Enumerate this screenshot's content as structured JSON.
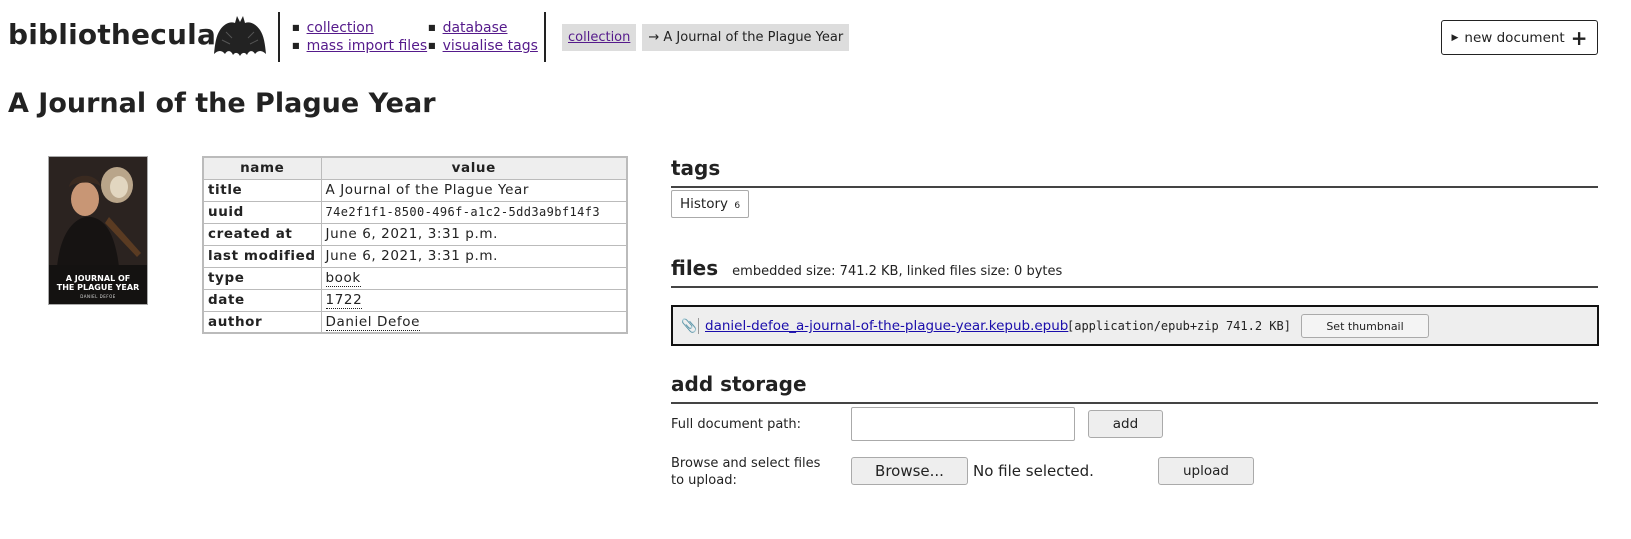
{
  "header": {
    "brand": "bibliothecula",
    "nav_col1": [
      "collection",
      "mass import files"
    ],
    "nav_col2": [
      "database",
      "visualise tags"
    ],
    "breadcrumb": {
      "link": "collection",
      "current": "→ A Journal of the Plague Year"
    },
    "new_document": "new document"
  },
  "page_title": "A Journal of the Plague Year",
  "thumbnail": {
    "title_line1": "A JOURNAL OF",
    "title_line2": "THE PLAGUE YEAR",
    "author": "DANIEL DEFOE"
  },
  "metadata": {
    "col_name": "name",
    "col_value": "value",
    "rows": [
      {
        "name": "title",
        "value": "A Journal of the Plague Year"
      },
      {
        "name": "uuid",
        "value": "74e2f1f1-8500-496f-a1c2-5dd3a9bf14f3"
      },
      {
        "name": "created at",
        "value": "June 6, 2021, 3:31 p.m."
      },
      {
        "name": "last modified",
        "value": "June 6, 2021, 3:31 p.m."
      },
      {
        "name": "type",
        "value": "book"
      },
      {
        "name": "date",
        "value": "1722"
      },
      {
        "name": "author",
        "value": "Daniel Defoe"
      }
    ]
  },
  "tags": {
    "heading": "tags",
    "items": [
      {
        "label": "History",
        "count": "6"
      }
    ]
  },
  "files": {
    "heading": "files",
    "info": "embedded size: 741.2 KB, linked files size: 0 bytes",
    "items": [
      {
        "filename": "daniel-defoe_a-journal-of-the-plague-year.kepub.epub",
        "mime": "[application/epub+zip 741.2 KB]",
        "thumb_button": "Set thumbnail"
      }
    ]
  },
  "storage": {
    "heading": "add storage",
    "path_label": "Full document path:",
    "path_value": "",
    "add_button": "add",
    "browse_label_line1": "Browse and select files",
    "browse_label_line2": "to upload:",
    "browse_button": "Browse...",
    "no_file": "No file selected.",
    "upload_button": "upload"
  }
}
